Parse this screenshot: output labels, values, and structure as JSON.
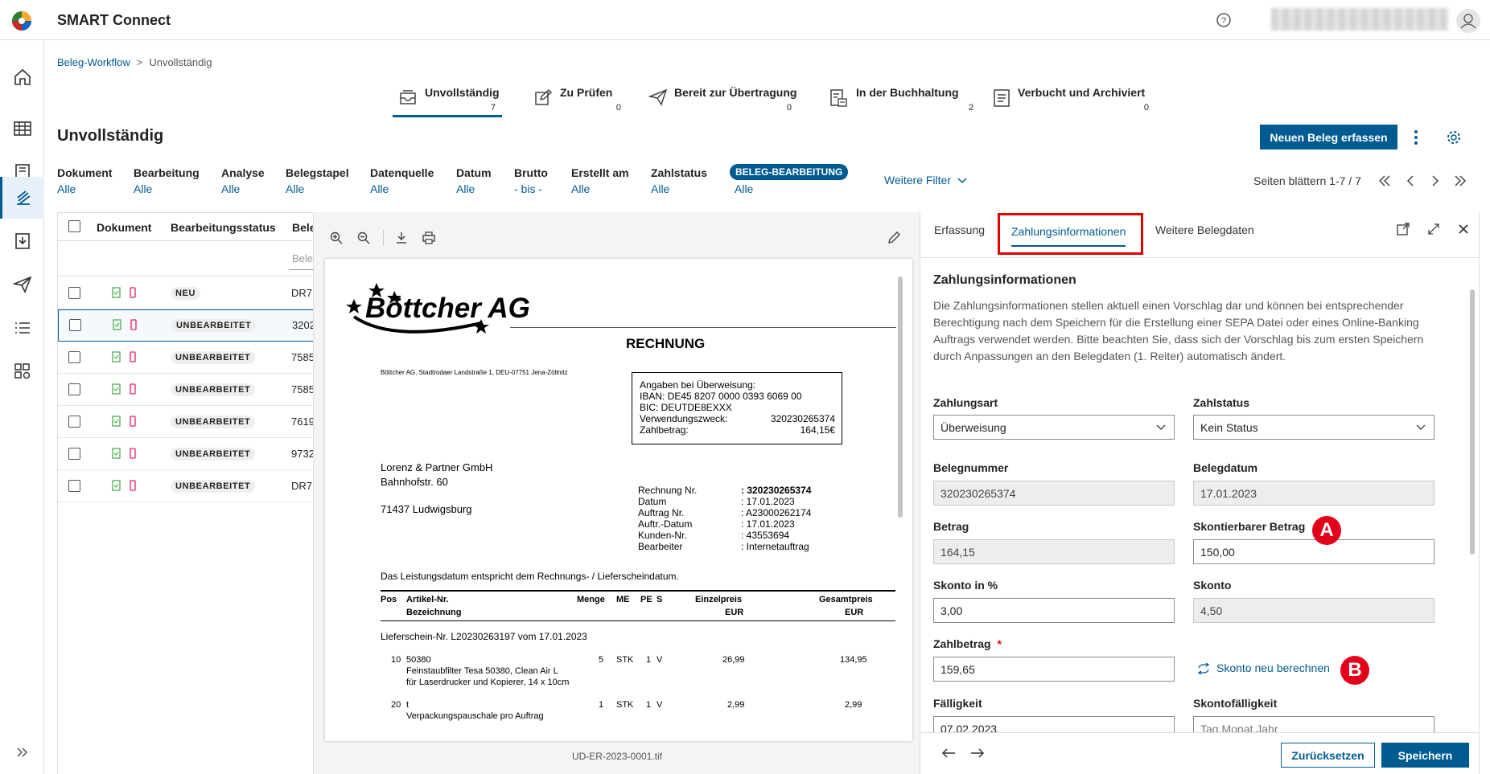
{
  "app": {
    "title": "SMART Connect"
  },
  "breadcrumb": {
    "root": "Beleg-Workflow",
    "sep": ">",
    "current": "Unvollständig"
  },
  "workflow_tabs": [
    {
      "label": "Unvollständig",
      "count": "7",
      "icon": "inbox-icon"
    },
    {
      "label": "Zu Prüfen",
      "count": "0",
      "icon": "edit-icon"
    },
    {
      "label": "Bereit zur Übertragung",
      "count": "0",
      "icon": "send-icon"
    },
    {
      "label": "In der Buchhaltung",
      "count": "2",
      "icon": "ledger-icon"
    },
    {
      "label": "Verbucht und Archiviert",
      "count": "0",
      "icon": "archive-icon"
    }
  ],
  "page": {
    "title": "Unvollständig",
    "new_button": "Neuen Beleg erfassen"
  },
  "filters": [
    {
      "label": "Dokument",
      "value": "Alle"
    },
    {
      "label": "Bearbeitung",
      "value": "Alle"
    },
    {
      "label": "Analyse",
      "value": "Alle"
    },
    {
      "label": "Belegstapel",
      "value": "Alle"
    },
    {
      "label": "Datenquelle",
      "value": "Alle"
    },
    {
      "label": "Datum",
      "value": "Alle"
    },
    {
      "label": "Brutto",
      "value": "- bis -"
    },
    {
      "label": "Erstellt am",
      "value": "Alle"
    },
    {
      "label": "Zahlstatus",
      "value": "Alle"
    },
    {
      "label": "BELEG-BEARBEITUNG",
      "value": "Alle"
    }
  ],
  "more_filters": "Weitere Filter",
  "paging": "Seiten blättern 1-7 / 7",
  "table": {
    "headers": [
      "Dokument",
      "Bearbeitungsstatus",
      "Bele"
    ],
    "filter_placeholder": "Bele",
    "rows": [
      {
        "status": "NEU",
        "beleg": "DR7"
      },
      {
        "status": "UNBEARBEITET",
        "beleg": "3202"
      },
      {
        "status": "UNBEARBEITET",
        "beleg": "7585"
      },
      {
        "status": "UNBEARBEITET",
        "beleg": "7585"
      },
      {
        "status": "UNBEARBEITET",
        "beleg": "7619"
      },
      {
        "status": "UNBEARBEITET",
        "beleg": "9732"
      },
      {
        "status": "UNBEARBEITET",
        "beleg": "DR7"
      }
    ]
  },
  "document": {
    "company": "Böttcher AG",
    "heading": "RECHNUNG",
    "sender_line": "Böttcher AG, Stadtrodaer Landstraße 1, DEU-07751 Jena-Zöllnitz",
    "transfer_box": {
      "title": "Angaben bei Überweisung:",
      "iban": "IBAN: DE45 8207 0000 0393 6069 00",
      "bic": "BIC: DEUTDE8EXXX",
      "purpose_label": "Verwendungszweck:",
      "purpose_value": "320230265374",
      "amount_label": "Zahlbetrag:",
      "amount_value": "164,15€"
    },
    "recipient": [
      "Lorenz & Partner GmbH",
      "Bahnhofstr. 60",
      "71437 Ludwigsburg"
    ],
    "meta": [
      {
        "k": "Rechnung Nr.",
        "v": ": 320230265374"
      },
      {
        "k": "Datum",
        "v": ": 17.01.2023"
      },
      {
        "k": "Auftrag Nr.",
        "v": ": A23000262174"
      },
      {
        "k": "Auftr.-Datum",
        "v": ": 17.01.2023"
      },
      {
        "k": "Kunden-Nr.",
        "v": ": 43553694"
      },
      {
        "k": "Bearbeiter",
        "v": ": Internetauftrag"
      }
    ],
    "service_note": "Das Leistungsdatum entspricht dem Rechnungs- / Lieferscheindatum.",
    "cols": {
      "pos": "Pos",
      "art": "Artikel-Nr.",
      "bez": "Bezeichnung",
      "menge": "Menge",
      "me": "ME",
      "pe": "PE",
      "s": "S",
      "ep": "Einzelpreis",
      "ep_cur": "EUR",
      "gp": "Gesamtpreis",
      "gp_cur": "EUR"
    },
    "delivery_note": "Lieferschein-Nr. L20230263197 vom 17.01.2023",
    "items": [
      {
        "pos": "10",
        "art": "50380",
        "desc1": "Feinstaubfilter Tesa 50380, Clean Air L",
        "desc2": "für Laserdrucker und Kopierer, 14 x 10cm",
        "menge": "5",
        "me": "STK",
        "pe": "1",
        "s": "V",
        "ep": "26,99",
        "gp": "134,95"
      },
      {
        "pos": "20",
        "art": "t",
        "desc1": "Verpackungspauschale pro Auftrag",
        "desc2": "",
        "menge": "1",
        "me": "STK",
        "pe": "1",
        "s": "V",
        "ep": "2,99",
        "gp": "2,99"
      }
    ],
    "filename": "UD-ER-2023-0001.tif"
  },
  "panel": {
    "tabs": [
      "Erfassung",
      "Zahlungsinformationen",
      "Weitere Belegdaten"
    ],
    "heading": "Zahlungsinformationen",
    "description": "Die Zahlungsinformationen stellen aktuell einen Vorschlag dar und können bei entsprechender Berechtigung nach dem Speichern für die Erstellung einer SEPA Datei oder eines Online-Banking Auftrags verwendet werden. Bitte beachten Sie, dass sich der Vorschlag bis zum ersten Speichern durch Anpassungen an den Belegdaten (1. Reiter) automatisch ändert.",
    "fields": {
      "zahlungsart": {
        "label": "Zahlungsart",
        "value": "Überweisung"
      },
      "zahlstatus": {
        "label": "Zahlstatus",
        "value": "Kein Status"
      },
      "belegnummer": {
        "label": "Belegnummer",
        "value": "320230265374"
      },
      "belegdatum": {
        "label": "Belegdatum",
        "value": "17.01.2023"
      },
      "betrag": {
        "label": "Betrag",
        "value": "164,15"
      },
      "skontierbar": {
        "label": "Skontierbarer Betrag",
        "value": "150,00"
      },
      "skonto_pct": {
        "label": "Skonto in %",
        "value": "3,00"
      },
      "skonto": {
        "label": "Skonto",
        "value": "4,50"
      },
      "zahlbetrag": {
        "label": "Zahlbetrag",
        "required": "*",
        "value": "159,65"
      },
      "faelligkeit": {
        "label": "Fälligkeit",
        "value": "07.02.2023"
      },
      "skontofaelligkeit": {
        "label": "Skontofälligkeit",
        "value": "Tag.Monat.Jahr"
      }
    },
    "recalc": "Skonto neu berechnen",
    "markers": {
      "a": "A",
      "b": "B"
    },
    "reset": "Zurücksetzen",
    "save": "Speichern"
  },
  "colors": {
    "primary": "#005b92",
    "highlight": "#e00000",
    "marker": "#e3001b"
  }
}
